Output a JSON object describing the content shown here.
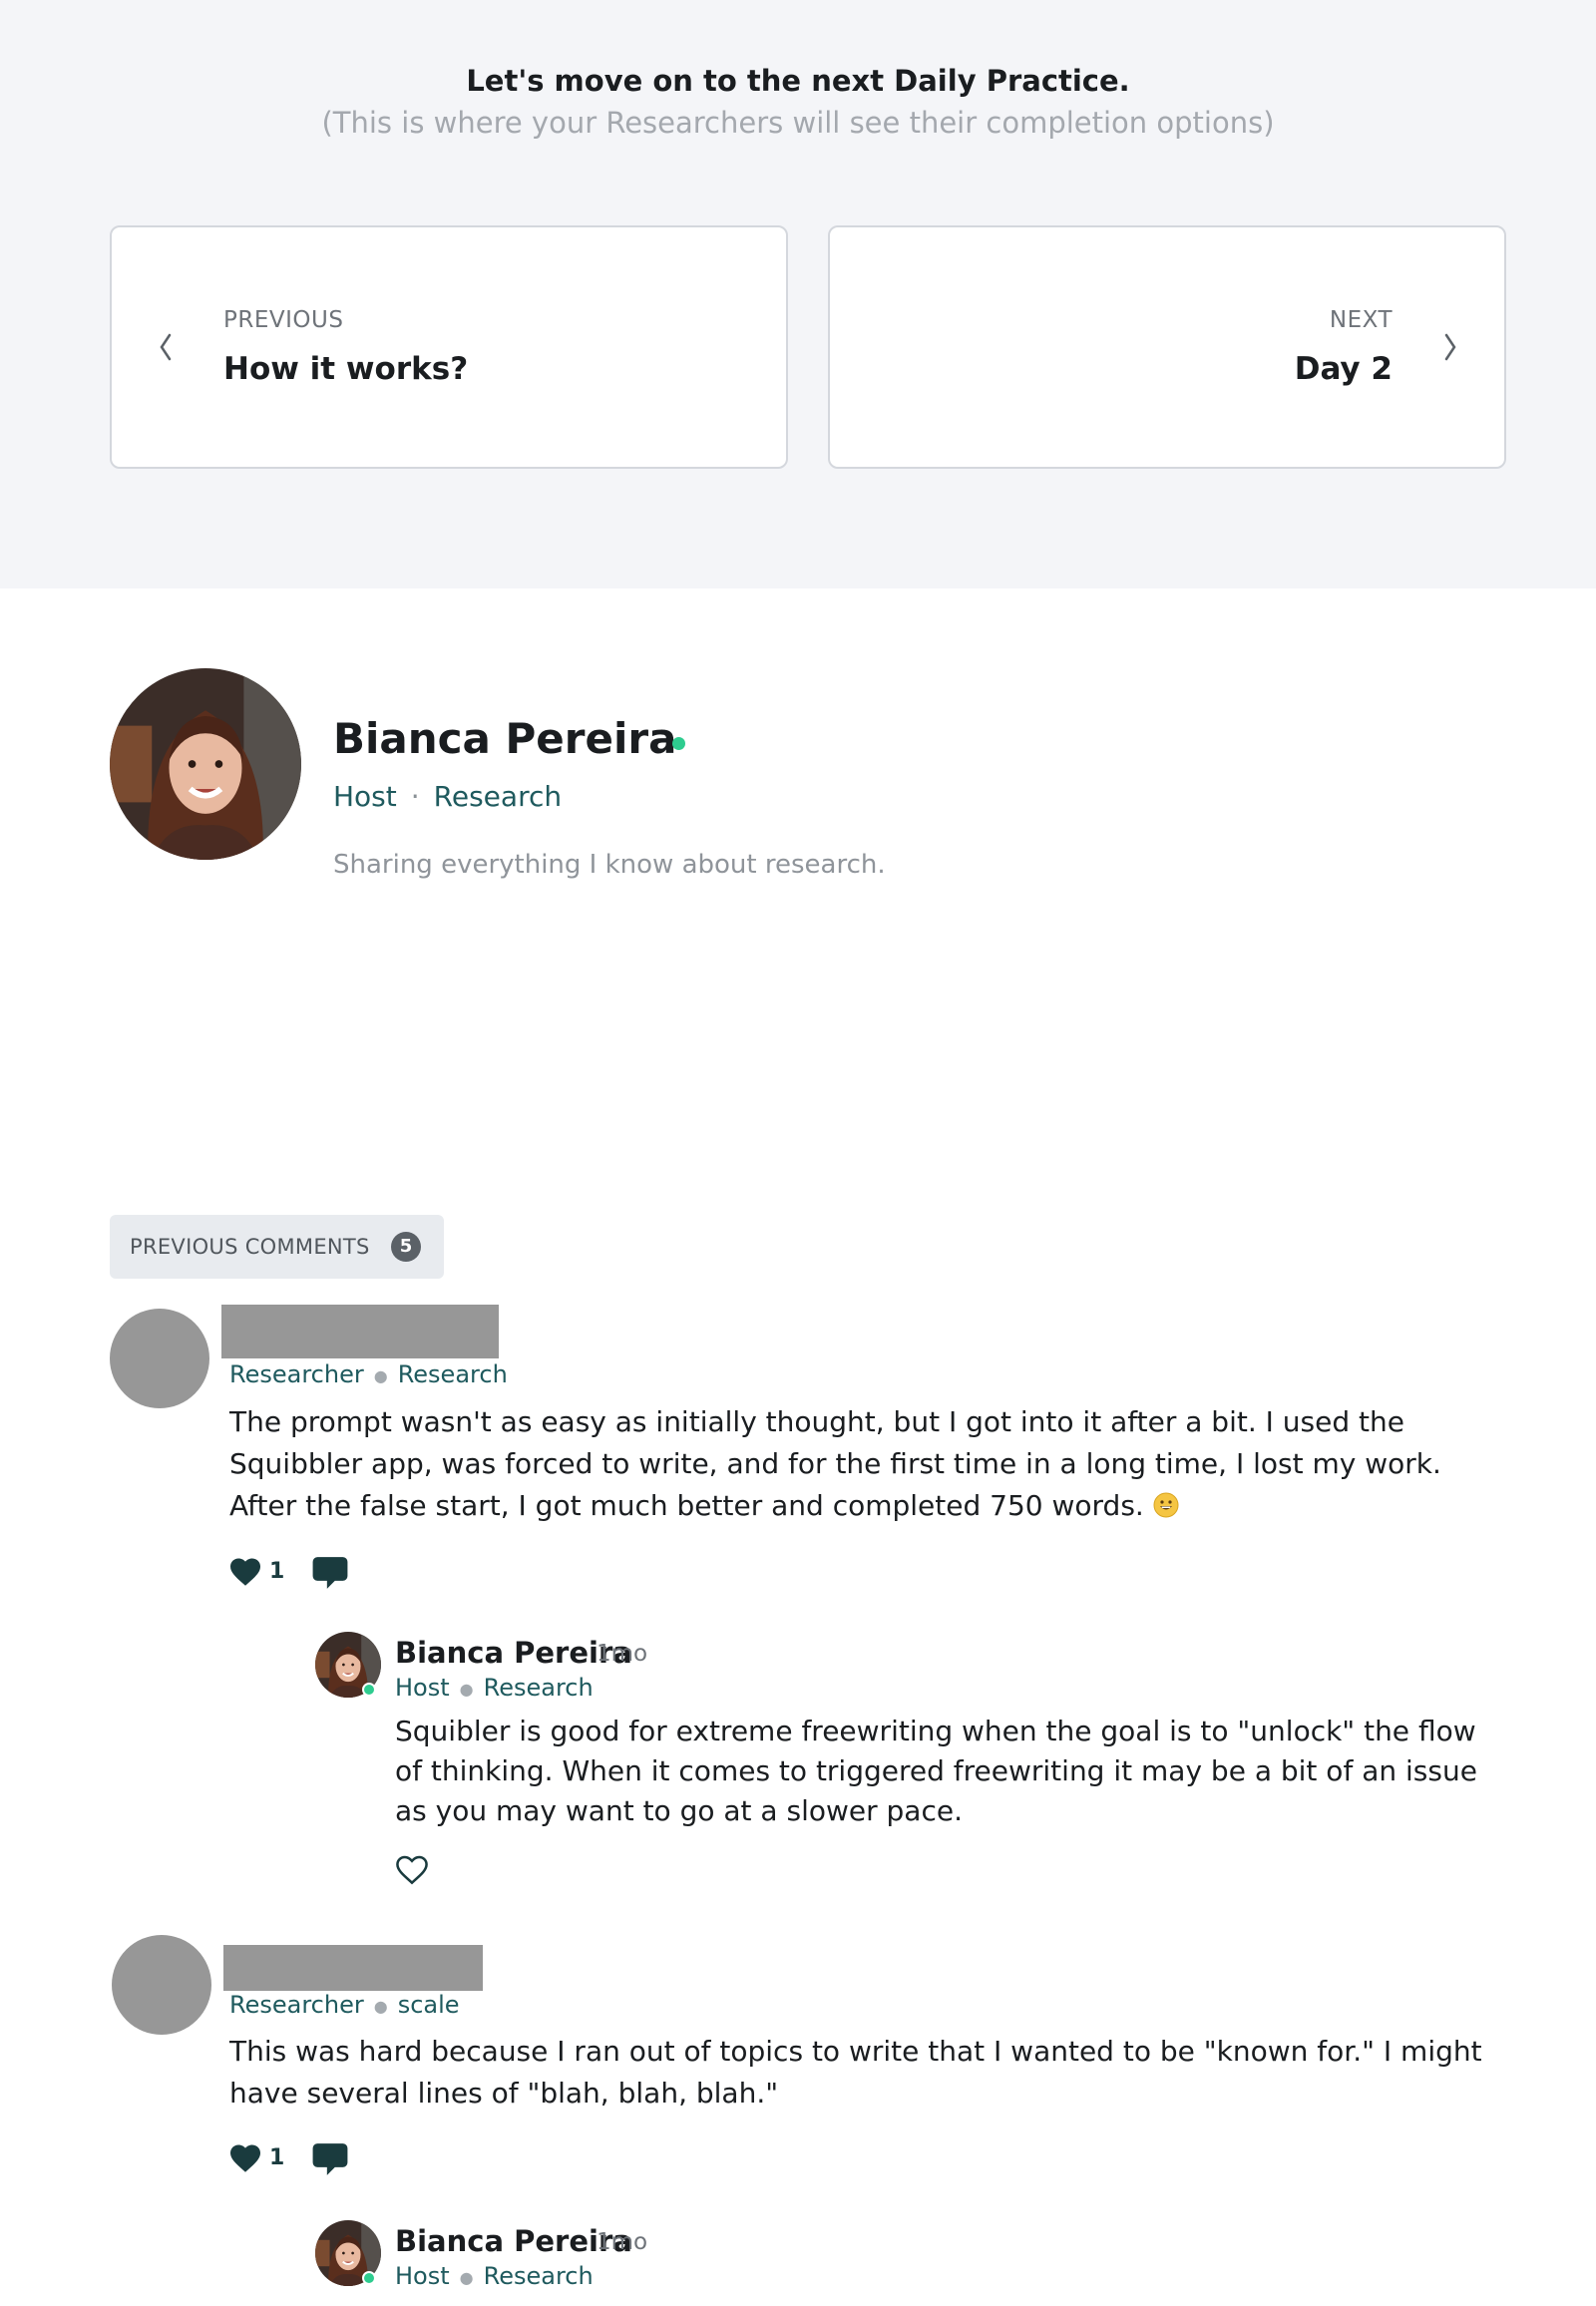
{
  "header": {
    "title": "Let's move on to the next Daily Practice.",
    "subtitle": "(This is where your Researchers will see their completion options)"
  },
  "nav": {
    "previous": {
      "label": "PREVIOUS",
      "title": "How it works?",
      "icon": "chevron-left-icon"
    },
    "next": {
      "label": "NEXT",
      "title": "Day 2",
      "icon": "chevron-right-icon"
    }
  },
  "host": {
    "name": "Bianca Pereira",
    "role": "Host",
    "separator": "·",
    "community": "Research",
    "bio": "Sharing everything I know about research.",
    "online_color": "#2ecc8f"
  },
  "comments_section": {
    "previous_label": "PREVIOUS COMMENTS",
    "previous_count": "5"
  },
  "comments": [
    {
      "role": "Researcher",
      "community": "Research",
      "text": "The prompt wasn't as easy as initially thought, but I got into it after a bit. I used the Squibbler app, was forced to write, and for the first time in a long time, I lost my work. After the false start, I got much better and completed 750 words.",
      "emoji": "grinning-face-icon",
      "likes": "1",
      "reply": {
        "name": "Bianca Pereira",
        "time": "1mo",
        "role": "Host",
        "community": "Research",
        "text": "Squibler is good for extreme freewriting when the goal is to \"unlock\" the flow of thinking. When it comes to triggered freewriting it may be a bit of an issue as you may want to go at a slower pace."
      }
    },
    {
      "role": "Researcher",
      "community": "scale",
      "text": "This was hard because I ran out of topics to write that I wanted to be \"known for.\"  I might have several lines of \"blah, blah, blah.\"",
      "likes": "1",
      "reply": {
        "name": "Bianca Pereira",
        "time": "1mo",
        "role": "Host",
        "community": "Research"
      }
    }
  ],
  "colors": {
    "accent": "#1f5a5e",
    "icon_dark": "#1a3b3e",
    "background_top": "#f4f5f8",
    "redaction": "#979797"
  }
}
